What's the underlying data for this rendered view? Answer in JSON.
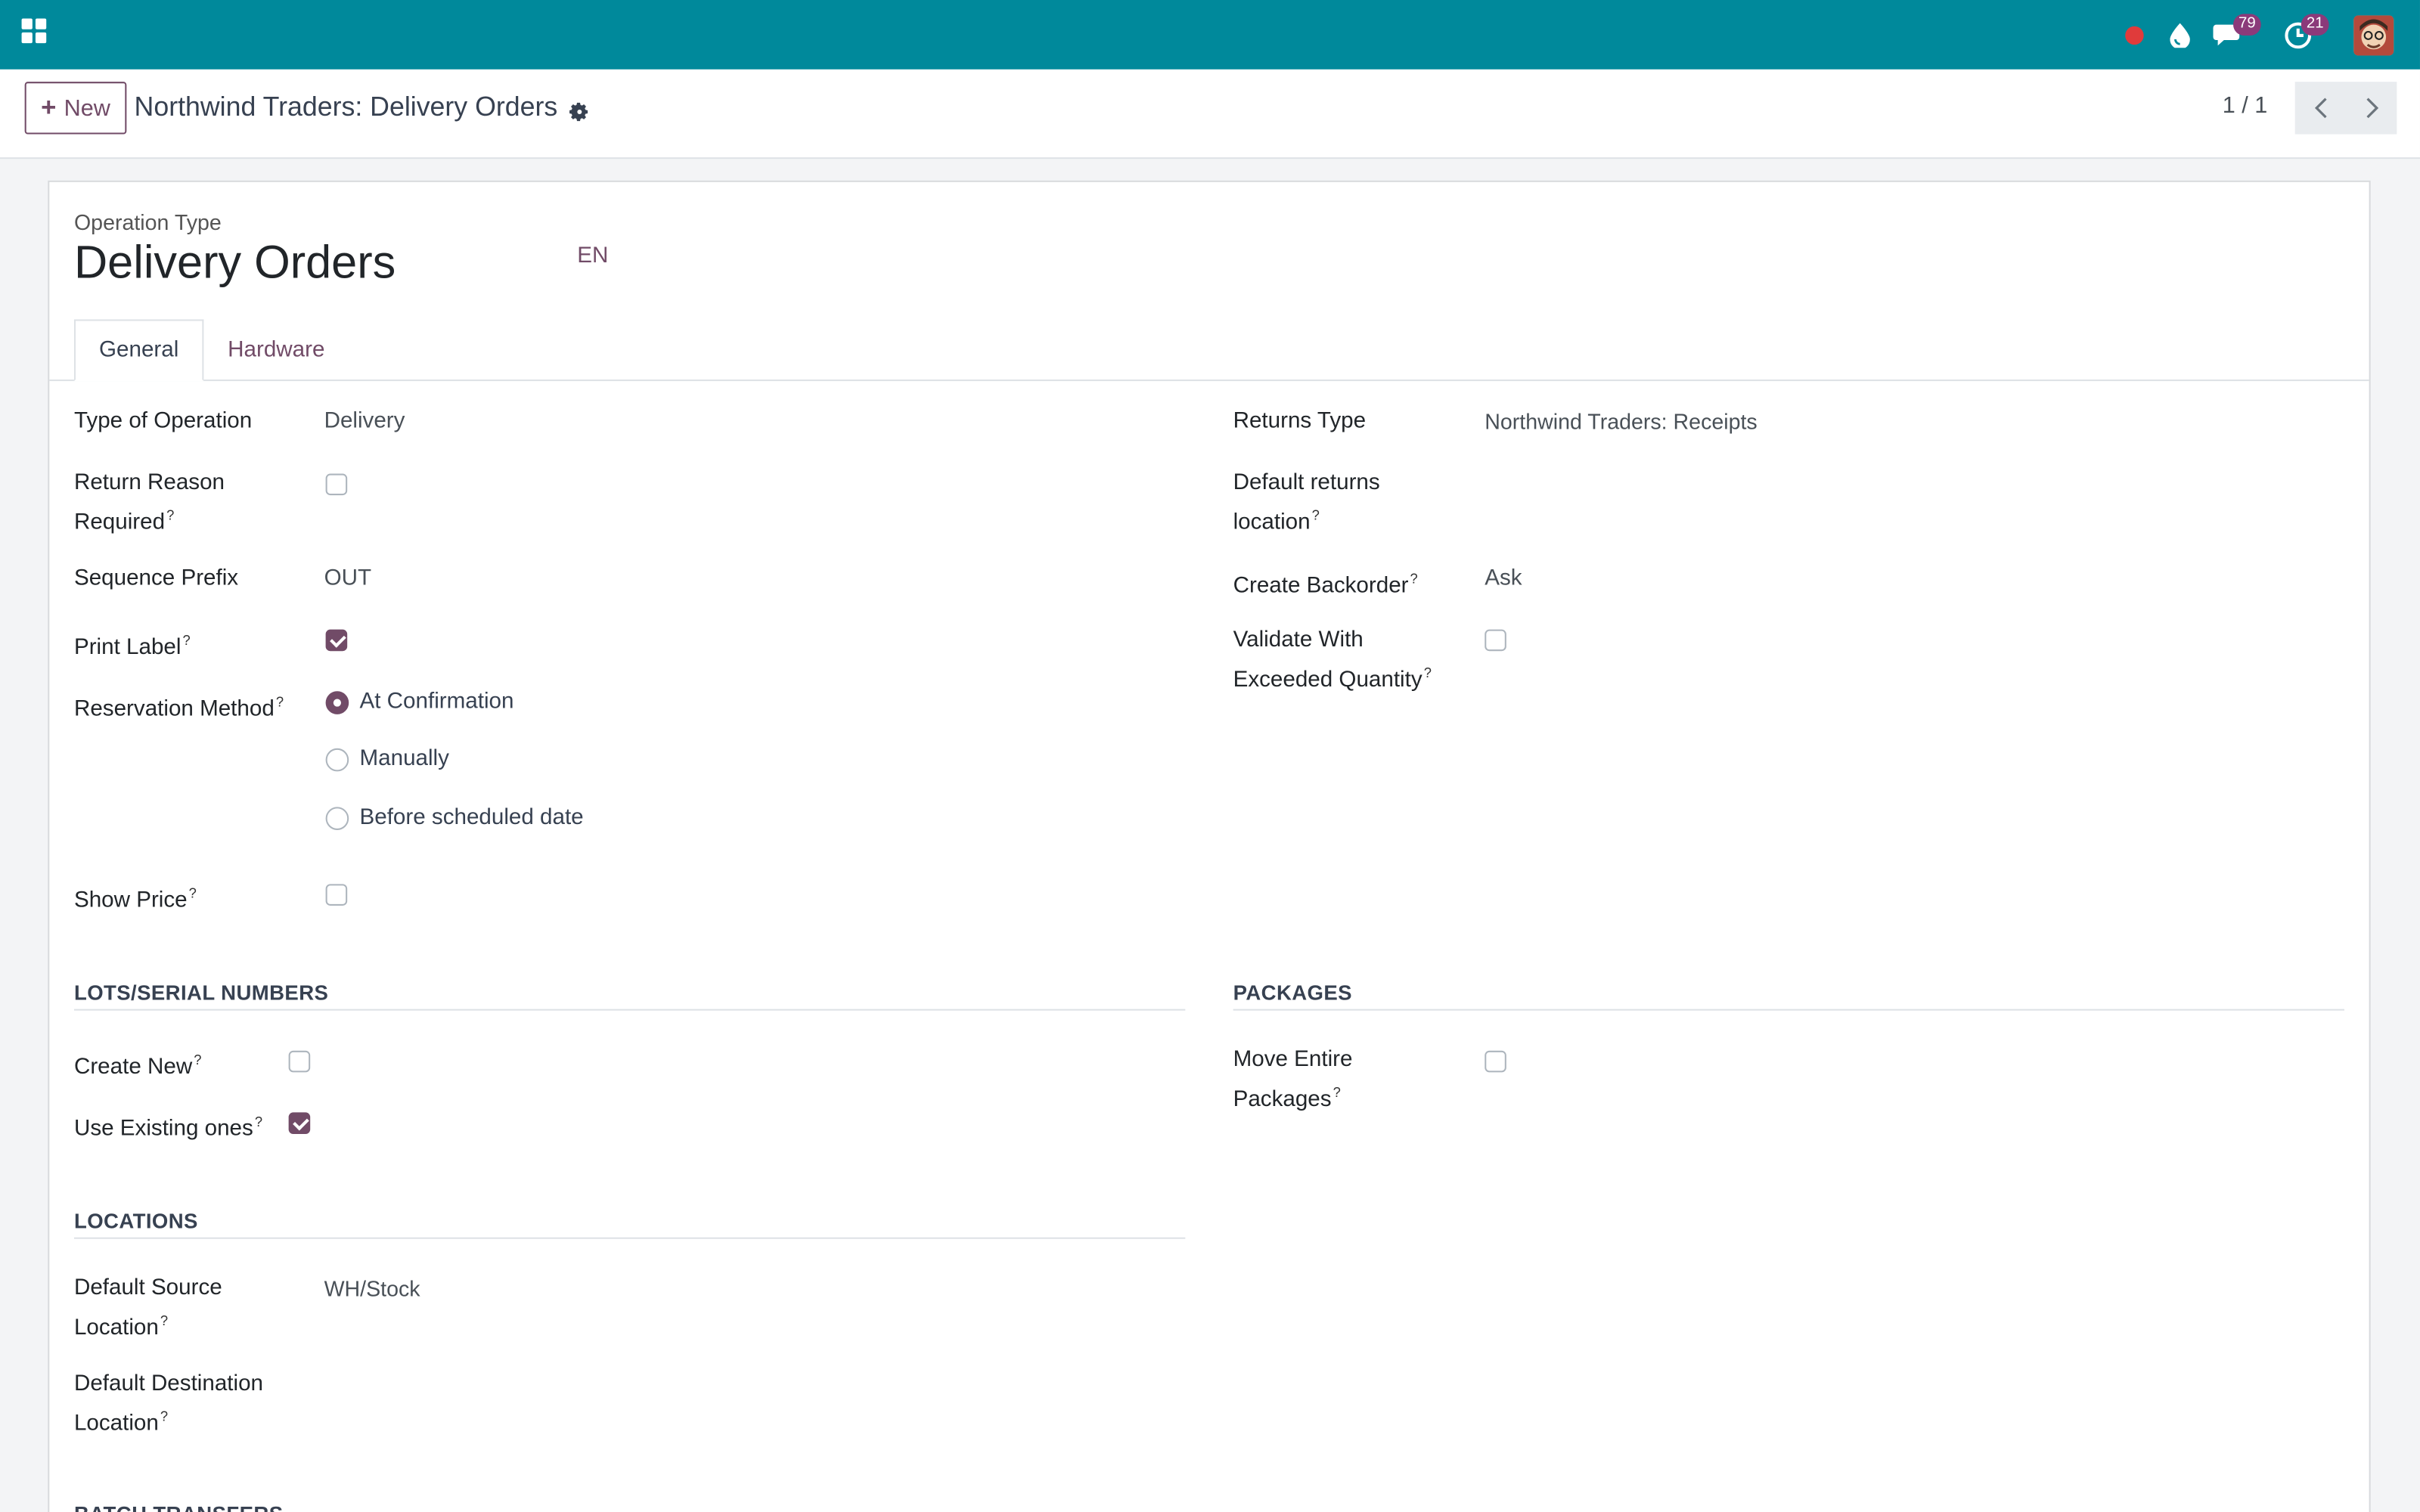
{
  "topbar": {
    "icons": [
      "apps-icon",
      "recording-dot-icon",
      "drop-icon",
      "chat-icon",
      "activity-clock-icon",
      "avatar"
    ],
    "messages_count": "79",
    "activities_count": "21",
    "accent_color": "#00899b"
  },
  "control_panel": {
    "new_button_label": "New",
    "breadcrumb": "Northwind Traders: Delivery Orders",
    "pager": "1 / 1"
  },
  "form": {
    "record_label": "Operation Type",
    "record_title": "Delivery Orders",
    "language": "EN",
    "tabs": [
      {
        "label": "General",
        "active": true
      },
      {
        "label": "Hardware",
        "active": false
      }
    ],
    "left": {
      "type_of_operation": {
        "label": "Type of Operation",
        "value": "Delivery"
      },
      "return_reason_required": {
        "label_line1": "Return Reason",
        "label_line2": "Required",
        "checked": false
      },
      "sequence_prefix": {
        "label": "Sequence Prefix",
        "value": "OUT"
      },
      "print_label": {
        "label": "Print Label",
        "checked": true
      },
      "reservation_method": {
        "label": "Reservation Method",
        "options": [
          "At Confirmation",
          "Manually",
          "Before scheduled date"
        ],
        "selected": "At Confirmation"
      },
      "show_price": {
        "label": "Show Price",
        "checked": false
      }
    },
    "right": {
      "returns_type": {
        "label": "Returns Type",
        "value": "Northwind Traders: Receipts"
      },
      "default_returns_location": {
        "label_line1": "Default returns",
        "label_line2": "location",
        "value": ""
      },
      "create_backorder": {
        "label": "Create Backorder",
        "value": "Ask"
      },
      "validate_exceeded": {
        "label_line1": "Validate With",
        "label_line2": "Exceeded Quantity",
        "checked": false
      }
    },
    "lots_section": {
      "title": "LOTS/SERIAL NUMBERS",
      "create_new": {
        "label": "Create New",
        "checked": false
      },
      "use_existing": {
        "label": "Use Existing ones",
        "checked": true
      }
    },
    "packages_section": {
      "title": "PACKAGES",
      "move_entire": {
        "label_line1": "Move Entire",
        "label_line2": "Packages",
        "checked": false
      }
    },
    "locations_section": {
      "title": "LOCATIONS",
      "default_source": {
        "label_line1": "Default Source",
        "label_line2": "Location",
        "value": "WH/Stock"
      },
      "default_destination": {
        "label_line1": "Default Destination",
        "label_line2": "Location",
        "value": ""
      }
    },
    "batch_section": {
      "title": "BATCH TRANSFERS"
    },
    "help_mark": "?"
  }
}
